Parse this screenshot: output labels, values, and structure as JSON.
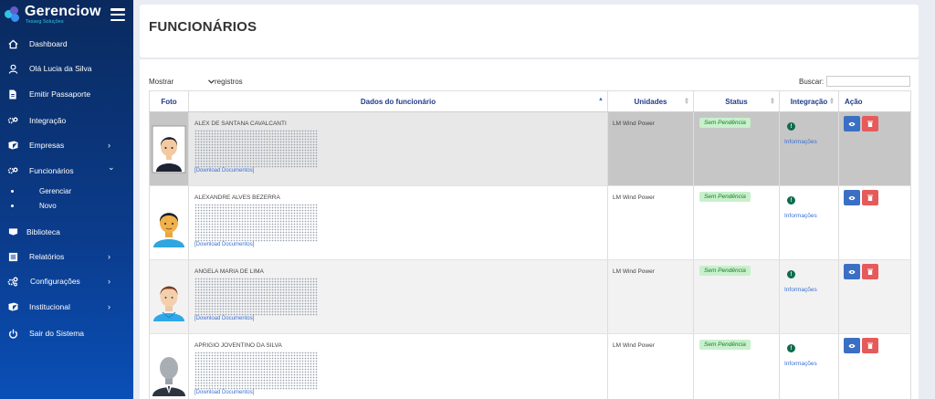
{
  "brand": {
    "name": "Gerenciow",
    "subtitle": "Tesseg Soluções"
  },
  "sidebar": {
    "items": [
      {
        "label": "Dashboard",
        "icon": "home-icon"
      },
      {
        "label": "Olá Lucia da Silva",
        "icon": "user-icon"
      },
      {
        "label": "Emitir Passaporte",
        "icon": "file-icon"
      },
      {
        "label": "Integração",
        "icon": "cogs-icon"
      },
      {
        "label": "Empresas",
        "icon": "book-icon",
        "chevron": "›"
      },
      {
        "label": "Funcionários",
        "icon": "cogs-icon",
        "chevron": "⌄"
      },
      {
        "label": "Biblioteca",
        "icon": "book-icon"
      },
      {
        "label": "Relatórios",
        "icon": "list-icon",
        "chevron": "›"
      },
      {
        "label": "Configurações",
        "icon": "settings-icon",
        "chevron": "›"
      },
      {
        "label": "Institucional",
        "icon": "book-icon",
        "chevron": "›"
      },
      {
        "label": "Sair do Sistema",
        "icon": "power-icon"
      }
    ],
    "subitems": [
      {
        "label": "Gerenciar"
      },
      {
        "label": "Novo"
      }
    ]
  },
  "page": {
    "title": "FUNCIONÁRIOS"
  },
  "table_controls": {
    "show_label": "Mostrar",
    "show_after": "registros",
    "search_label": "Buscar:",
    "search_value": ""
  },
  "columns": [
    "Foto",
    "Dados do funcionário",
    "Unidades",
    "Status",
    "Integração",
    "Ação"
  ],
  "rows": [
    {
      "name": "ALEX DE SANTANA CAVALCANTI",
      "doc_link": "[Download Documentos]",
      "unit": "LM Wind Power",
      "status": "Sem Pendência",
      "integration_badge": "!",
      "integration_link": "Informações",
      "avatar": "avatar-dark-hair"
    },
    {
      "name": "ALEXANDRE ALVES BEZERRA",
      "doc_link": "[Download Documentos]",
      "unit": "LM Wind Power",
      "status": "Sem Pendência",
      "integration_badge": "!",
      "integration_link": "Informações",
      "avatar": "avatar-yellow"
    },
    {
      "name": "ANGELA MARIA DE LIMA",
      "doc_link": "[Download Documentos]",
      "unit": "LM Wind Power",
      "status": "Sem Pendência",
      "integration_badge": "!",
      "integration_link": "Informações",
      "avatar": "avatar-blue"
    },
    {
      "name": "APRIGIO JOVENTINO DA SILVA",
      "doc_link": "[Download Documentos]",
      "unit": "LM Wind Power",
      "status": "Sem Pendência",
      "integration_badge": "!",
      "integration_link": "Informações",
      "avatar": "avatar-gray-silhouette"
    }
  ],
  "colors": {
    "sidebar_top": "#0a2a5e",
    "sidebar_bottom": "#0a4fb8",
    "accent": "#1f3a8a",
    "view_button": "#3b6fc4",
    "delete_button": "#e65a5a",
    "status_bg": "#c8f0cc"
  }
}
